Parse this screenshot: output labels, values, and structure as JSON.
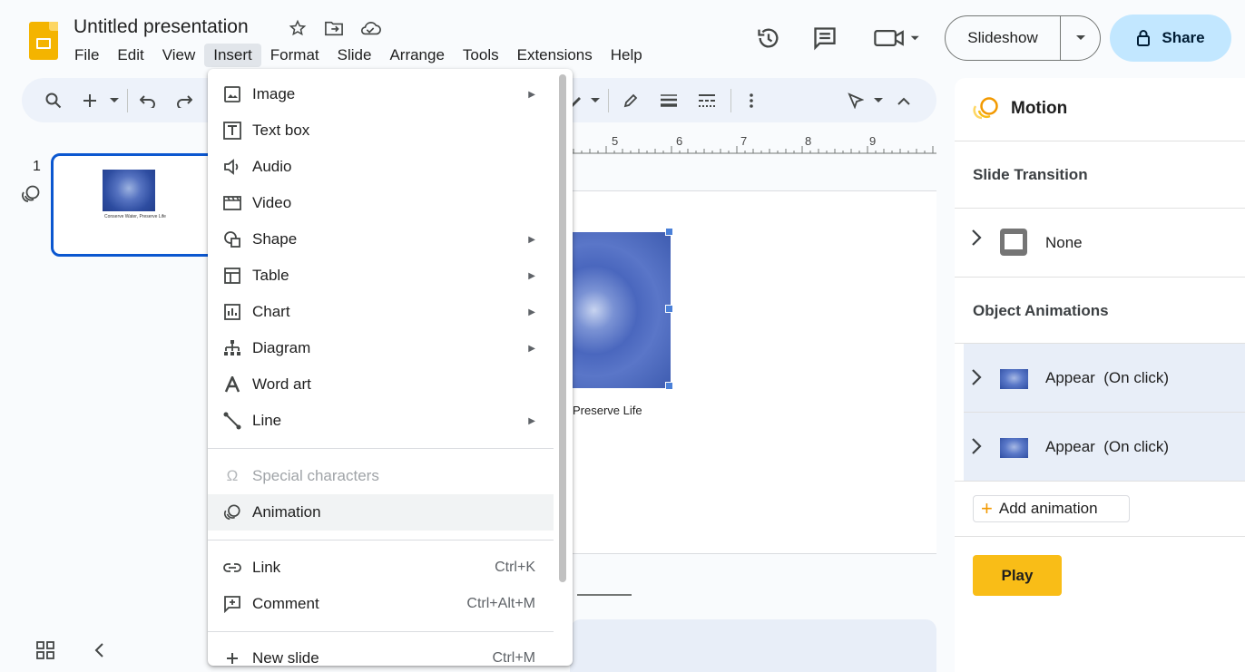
{
  "header": {
    "doc_title": "Untitled presentation",
    "menus": [
      "File",
      "Edit",
      "View",
      "Insert",
      "Format",
      "Slide",
      "Arrange",
      "Tools",
      "Extensions",
      "Help"
    ],
    "active_menu": "Insert",
    "slideshow_label": "Slideshow",
    "share_label": "Share"
  },
  "filmstrip": {
    "slide_number": "1",
    "thumb_caption": "Conserve Water, Preserve Life"
  },
  "ruler": {
    "numbers": [
      "5",
      "6",
      "7",
      "8",
      "9"
    ]
  },
  "slide": {
    "caption": "Preserve Life"
  },
  "insert_menu": {
    "items": [
      {
        "label": "Image",
        "icon": "image-icon",
        "submenu": true
      },
      {
        "label": "Text box",
        "icon": "text-box-icon",
        "submenu": false
      },
      {
        "label": "Audio",
        "icon": "audio-icon",
        "submenu": false
      },
      {
        "label": "Video",
        "icon": "video-icon",
        "submenu": false
      },
      {
        "label": "Shape",
        "icon": "shape-icon",
        "submenu": true
      },
      {
        "label": "Table",
        "icon": "table-icon",
        "submenu": true
      },
      {
        "label": "Chart",
        "icon": "chart-icon",
        "submenu": true
      },
      {
        "label": "Diagram",
        "icon": "diagram-icon",
        "submenu": true
      },
      {
        "label": "Word art",
        "icon": "word-art-icon",
        "submenu": false
      },
      {
        "label": "Line",
        "icon": "line-icon",
        "submenu": true
      },
      {
        "label": "Special characters",
        "icon": "omega-icon",
        "disabled": true
      },
      {
        "label": "Animation",
        "icon": "animation-icon",
        "highlighted": true
      },
      {
        "label": "Link",
        "icon": "link-icon",
        "shortcut": "Ctrl+K"
      },
      {
        "label": "Comment",
        "icon": "comment-icon",
        "shortcut": "Ctrl+Alt+M"
      },
      {
        "label": "New slide",
        "icon": "plus-icon",
        "shortcut": "Ctrl+M"
      }
    ]
  },
  "motion_panel": {
    "title": "Motion",
    "slide_transition_heading": "Slide Transition",
    "transition_value": "None",
    "object_animations_heading": "Object Animations",
    "animations": [
      {
        "label": "Appear  (On click)"
      },
      {
        "label": "Appear  (On click)"
      }
    ],
    "add_animation_label": "Add animation",
    "play_label": "Play"
  },
  "colors": {
    "accent_blue": "#0b57d0",
    "share_bg": "#c2e7ff",
    "play_yellow": "#f9bd17",
    "logo_yellow": "#f4b400"
  }
}
